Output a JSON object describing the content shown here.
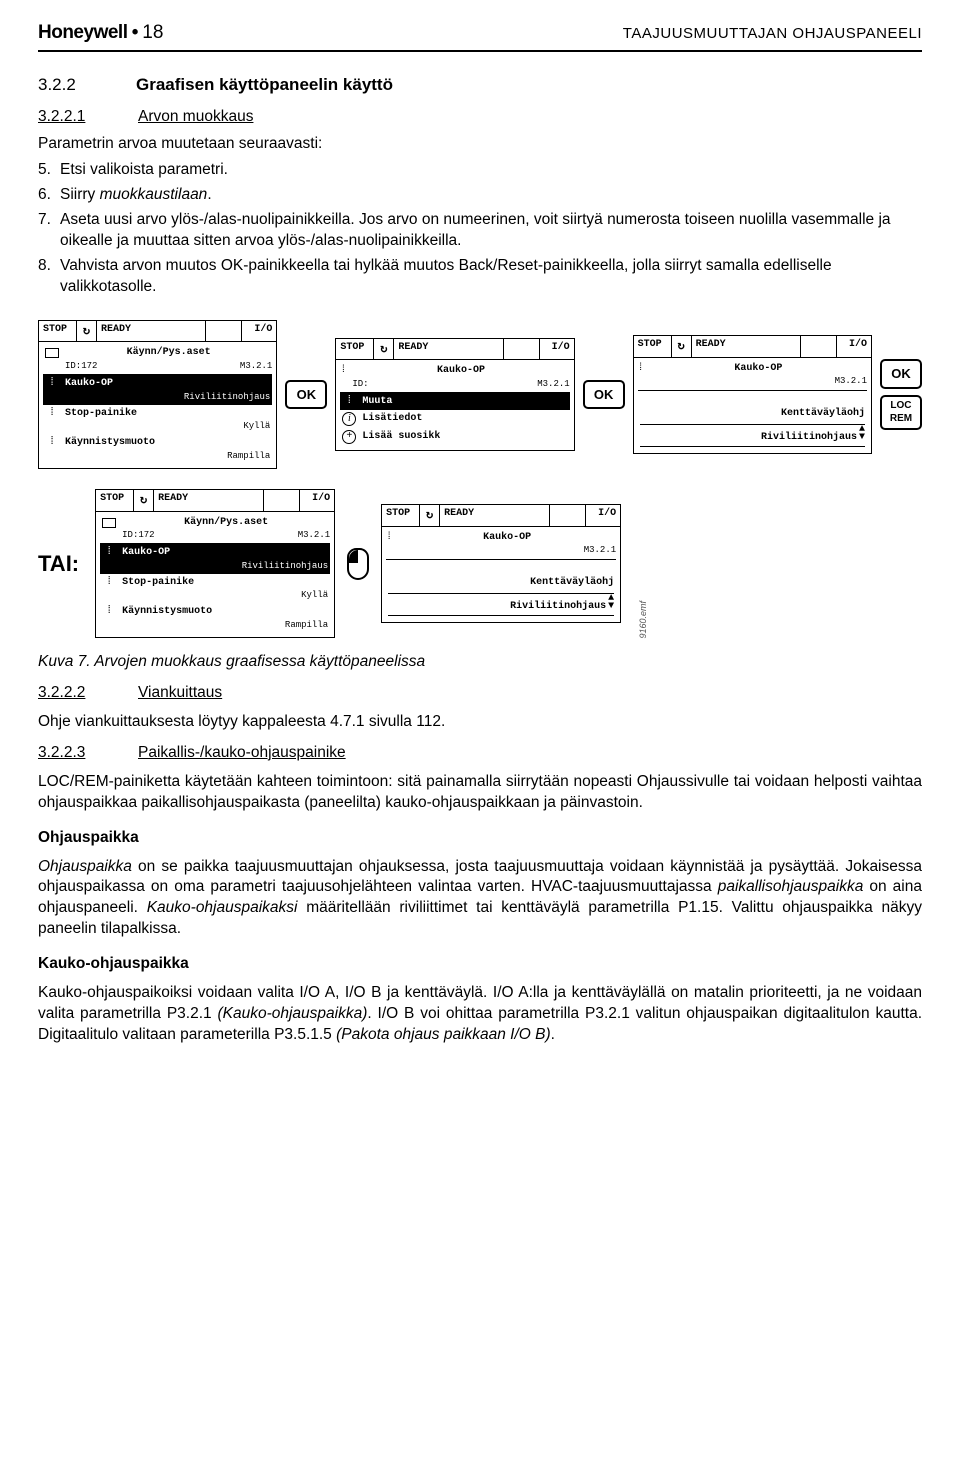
{
  "header": {
    "brand": "Honeywell",
    "page_number": "18",
    "doc_section": "TAAJUUSMUUTTAJAN OHJAUSPANEELI"
  },
  "section": {
    "num": "3.2.2",
    "title": "Graafisen käyttöpaneelin käyttö"
  },
  "sub1": {
    "num": "3.2.2.1",
    "title": "Arvon muokkaus",
    "intro": "Parametrin arvoa muutetaan seuraavasti:",
    "steps": {
      "n5": "5.",
      "t5": "Etsi valikoista parametri.",
      "n6": "6.",
      "t6_a": "Siirry ",
      "t6_b": "muokkaustilaan",
      "t6_c": ".",
      "n7": "7.",
      "t7": "Aseta uusi arvo ylös-/alas-nuolipainikkeilla. Jos arvo on numeerinen, voit siirtyä numerosta toiseen nuolilla vasemmalle ja oikealle ja muuttaa sitten arvoa ylös-/alas-nuolipainikkeilla.",
      "n8": "8.",
      "t8": "Vahvista arvon muutos OK-painikkeella tai hylkää muutos Back/Reset-painikkeella, jolla siirryt samalla edelliselle valikkotasolle."
    }
  },
  "panel_labels": {
    "stop": "STOP",
    "ready": "READY",
    "io": "I/O"
  },
  "row1": {
    "p1": {
      "title": "Käynn/Pys.aset",
      "id_left": "ID:172",
      "id_right": "M3.2.1",
      "i1_a": "Kauko-OP",
      "i1_b": "Riviliitinohjaus",
      "i2_a": "Stop-painike",
      "i2_b": "Kyllä",
      "i3_a": "Käynnistysmuoto",
      "i3_b": "Rampilla"
    },
    "ok1": "OK",
    "p2": {
      "title": "Kauko-OP",
      "id_left": "ID:",
      "id_right": "M3.2.1",
      "i1": "Muuta",
      "i2": "Lisätiedot",
      "i3": "Lisää suosikk"
    },
    "ok2": "OK",
    "p3": {
      "title": "Kauko-OP",
      "id_right": "M3.2.1",
      "i1": "Kenttäväyläohj",
      "i2": "Riviliitinohjaus"
    },
    "ok3": "OK",
    "locrem_a": "LOC",
    "locrem_b": "REM"
  },
  "tai": "TAI:",
  "row2": {
    "p1": {
      "title": "Käynn/Pys.aset",
      "id_left": "ID:172",
      "id_right": "M3.2.1",
      "i1_a": "Kauko-OP",
      "i1_b": "Riviliitinohjaus",
      "i2_a": "Stop-painike",
      "i2_b": "Kyllä",
      "i3_a": "Käynnistysmuoto",
      "i3_b": "Rampilla"
    },
    "p2": {
      "title": "Kauko-OP",
      "id_right": "M3.2.1",
      "i1": "Kenttäväyläohj",
      "i2": "Riviliitinohjaus"
    },
    "emf": "9160.emf"
  },
  "caption": "Kuva 7. Arvojen muokkaus graafisessa käyttöpaneelissa",
  "sub2": {
    "num": "3.2.2.2",
    "title": "Viankuittaus",
    "body": "Ohje viankuittauksesta löytyy kappaleesta 4.7.1 sivulla 112."
  },
  "sub3": {
    "num": "3.2.2.3",
    "title": "Paikallis-/kauko-ohjauspainike",
    "body": "LOC/REM-painiketta käytetään kahteen toimintoon: sitä painamalla siirrytään nopeasti Ohjaussivulle tai voidaan helposti vaihtaa ohjauspaikkaa paikallisohjauspaikasta (paneelilta) kauko-ohjauspaikkaan ja päinvastoin."
  },
  "op_h": "Ohjauspaikka",
  "op_body_a": "Ohjauspaikka",
  "op_body_b": " on se paikka taajuusmuuttajan ohjauksessa, josta taajuusmuuttaja voidaan käynnistää ja pysäyttää. Jokaisessa ohjauspaikassa on oma parametri taajuusohjelähteen valintaa varten. HVAC-taajuusmuuttajassa ",
  "op_body_c": "paikallisohjauspaikka",
  "op_body_d": " on aina ohjauspaneeli. ",
  "op_body_e": "Kauko-ohjauspaikaksi",
  "op_body_f": " määritellään riviliittimet tai kenttäväylä parametrilla P1.15. Valittu ohjauspaikka näkyy paneelin tilapalkissa.",
  "ko_h": "Kauko-ohjauspaikka",
  "ko_body_a": "Kauko-ohjauspaikoiksi voidaan valita I/O A, I/O B ja kenttäväylä. I/O A:lla ja kenttäväylällä on matalin prioriteetti, ja ne voidaan valita parametrilla P3.2.1 ",
  "ko_body_b": "(Kauko-ohjauspaikka)",
  "ko_body_c": ". I/O B voi ohittaa parametrilla P3.2.1 valitun ohjauspaikan digitaalitulon kautta. Digitaalitulo valitaan parameterilla P3.5.1.5 ",
  "ko_body_d": "(Pakota ohjaus paikkaan I/O B)",
  "ko_body_e": "."
}
